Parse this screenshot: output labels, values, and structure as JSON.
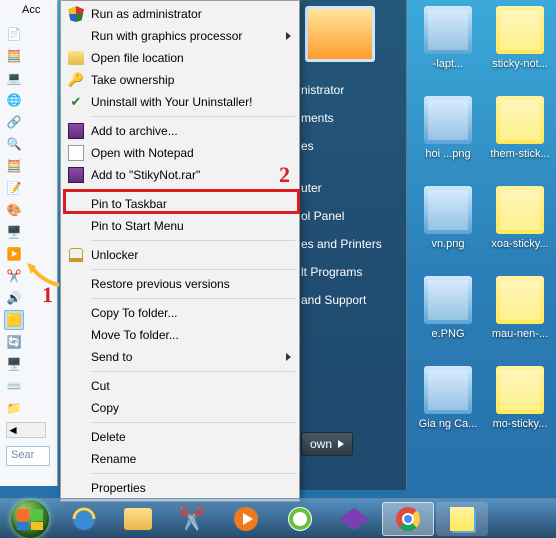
{
  "explorer": {
    "title": "Acc",
    "search_placeholder": "Sear"
  },
  "annotations": {
    "label1": "1",
    "label2": "2"
  },
  "desktop_icons": [
    {
      "label": "-lapt...",
      "kind": "img"
    },
    {
      "label": "sticky-not...",
      "kind": "note"
    },
    {
      "label": "hoi ...png",
      "kind": "img"
    },
    {
      "label": "them-stick...",
      "kind": "note"
    },
    {
      "label": "vn.png",
      "kind": "img"
    },
    {
      "label": "xoa-sticky...",
      "kind": "note"
    },
    {
      "label": "e.PNG",
      "kind": "img"
    },
    {
      "label": "mau-nen-...",
      "kind": "note"
    },
    {
      "label": "Gia ng Ca...",
      "kind": "img"
    },
    {
      "label": "mo-sticky...",
      "kind": "note"
    }
  ],
  "start_items": [
    "nistrator",
    "ments",
    "es",
    "",
    "uter",
    "ol Panel",
    "es and Printers",
    "lt Programs",
    "and Support"
  ],
  "shutdown_label": "own",
  "context_menu": {
    "items": [
      {
        "label": "Run as administrator",
        "icon": "shield"
      },
      {
        "label": "Run with graphics processor",
        "submenu": true
      },
      {
        "label": "Open file location",
        "icon": "folder"
      },
      {
        "label": "Take ownership",
        "icon": "key"
      },
      {
        "label": "Uninstall with Your Uninstaller!",
        "icon": "app"
      },
      {
        "sep": true
      },
      {
        "label": "Add to archive...",
        "icon": "rar"
      },
      {
        "label": "Open with Notepad",
        "icon": "note"
      },
      {
        "label": "Add to \"StikyNot.rar\"",
        "icon": "rar"
      },
      {
        "sep": true
      },
      {
        "label": "Pin to Taskbar",
        "highlighted": true
      },
      {
        "label": "Pin to Start Menu"
      },
      {
        "sep": true
      },
      {
        "label": "Unlocker",
        "icon": "lock"
      },
      {
        "sep": true
      },
      {
        "label": "Restore previous versions"
      },
      {
        "sep": true
      },
      {
        "label": "Copy To folder..."
      },
      {
        "label": "Move To folder..."
      },
      {
        "label": "Send to",
        "submenu": true
      },
      {
        "sep": true
      },
      {
        "label": "Cut"
      },
      {
        "label": "Copy"
      },
      {
        "sep": true
      },
      {
        "label": "Delete"
      },
      {
        "label": "Rename"
      },
      {
        "sep": true
      },
      {
        "label": "Properties"
      }
    ]
  },
  "taskbar": {
    "buttons": [
      {
        "name": "start-orb"
      },
      {
        "name": "ie"
      },
      {
        "name": "explorer"
      },
      {
        "name": "snipping-tool"
      },
      {
        "name": "media-player"
      },
      {
        "name": "coccoc"
      },
      {
        "name": "video-app"
      },
      {
        "name": "chrome",
        "active": true
      },
      {
        "name": "sticky-notes"
      }
    ]
  }
}
